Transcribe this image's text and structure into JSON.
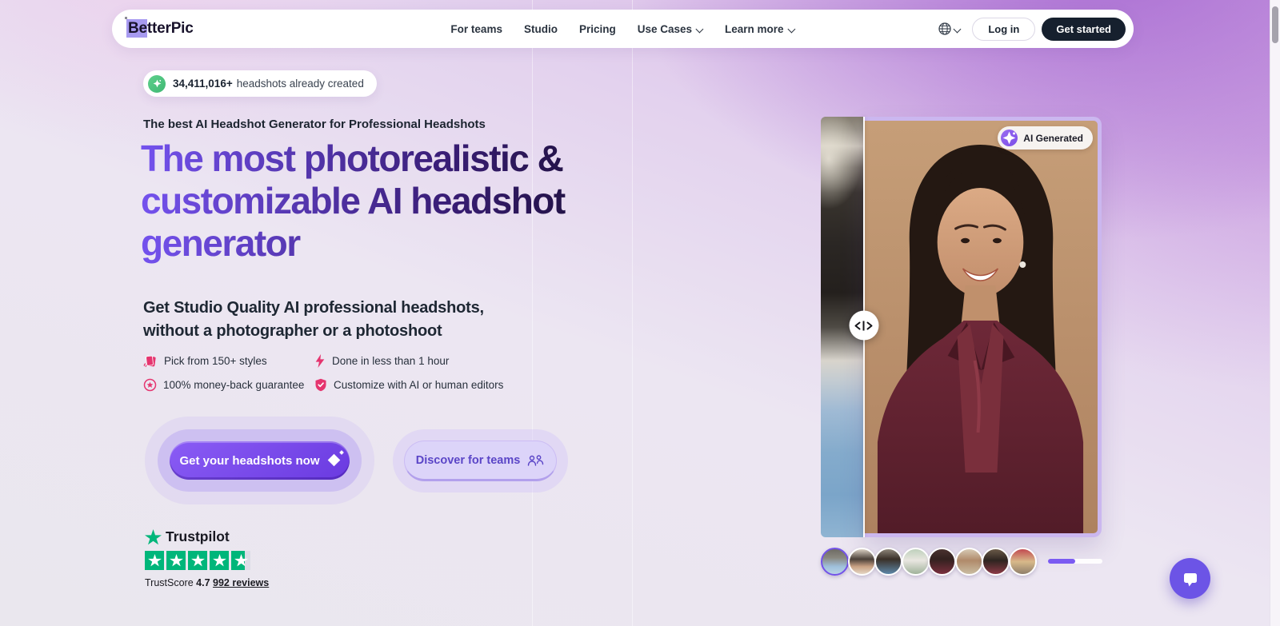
{
  "header": {
    "logo": "BetterPic",
    "nav": [
      {
        "label": "For teams",
        "dropdown": false
      },
      {
        "label": "Studio",
        "dropdown": false
      },
      {
        "label": "Pricing",
        "dropdown": false
      },
      {
        "label": "Use Cases",
        "dropdown": true
      },
      {
        "label": "Learn more",
        "dropdown": true
      }
    ],
    "language_icon": "globe-icon",
    "login_label": "Log in",
    "get_started_label": "Get started"
  },
  "hero": {
    "badge_count": "34,411,016+",
    "badge_text": "headshots already created",
    "badge_icon": "sparkle-icon",
    "eyebrow": "The best AI Headshot Generator for Professional Headshots",
    "heading_line1": "The most photorealistic &",
    "heading_line2": "customizable AI headshot",
    "heading_line3": "generator",
    "subheading_line1": "Get Studio Quality AI professional headshots,",
    "subheading_line2": "without a photographer or a photoshoot",
    "features": [
      {
        "icon": "style-cards-icon",
        "label": "Pick from 150+ styles"
      },
      {
        "icon": "lightning-icon",
        "label": "Done in less than 1 hour"
      },
      {
        "icon": "medal-icon",
        "label": "100% money-back guarantee"
      },
      {
        "icon": "shield-check-icon",
        "label": "Customize with AI or human editors"
      }
    ],
    "primary_cta": "Get your headshots now",
    "primary_cta_icon": "diamond-sparkle-icon",
    "secondary_cta": "Discover for teams",
    "secondary_cta_icon": "team-people-icon",
    "trustpilot": {
      "brand": "Trustpilot",
      "score_prefix": "TrustScore",
      "score": "4.7",
      "reviews": "992 reviews",
      "stars_total": 5,
      "last_star_fill": 0.7
    }
  },
  "showcase": {
    "ai_badge": "AI Generated",
    "slider_position_pct": 15.3,
    "thumbnails": [
      "user-headshot-1",
      "user-headshot-2",
      "user-headshot-3",
      "user-headshot-4",
      "user-headshot-5",
      "user-headshot-6",
      "user-headshot-7",
      "user-headshot-8"
    ],
    "selected_thumbnail_index": 0,
    "progress_pct": 50
  },
  "colors": {
    "accent_purple": "#7350EC",
    "heading_gradient_start": "#7452EE",
    "heading_gradient_end": "#140B26",
    "feature_pink": "#E5356F",
    "trustpilot_green": "#00B67A",
    "star_empty": "#DCDCE6",
    "dark_button": "#16202E",
    "badge_green": "#4EC281",
    "chat_purple": "#6C54E6"
  }
}
